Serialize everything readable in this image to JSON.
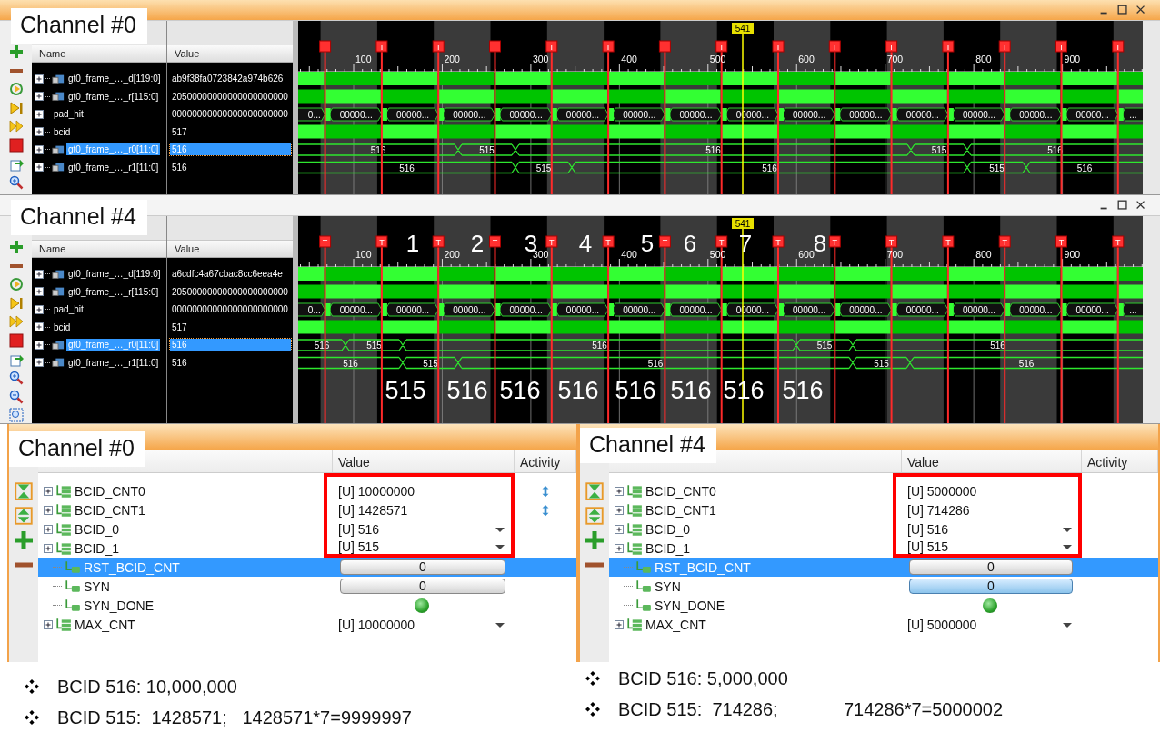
{
  "waveform_panels": [
    {
      "channel_label": "Channel #0",
      "active": true,
      "columns": [
        "Name",
        "Value"
      ],
      "cursor": "541",
      "ruler": [
        "100",
        "200",
        "300",
        "400",
        "500",
        "600",
        "700",
        "800",
        "900"
      ],
      "markers": [
        "T",
        "T",
        "T",
        "T",
        "T",
        "T",
        "T",
        "T",
        "T",
        "T",
        "T",
        "T",
        "T",
        "T",
        "T"
      ],
      "signals": [
        {
          "name": "gt0_frame_…_d[119:0]",
          "value": "ab9f38fa0723842a974b626",
          "kind": "bus",
          "selected": false,
          "trace": {
            "kind": "solid"
          }
        },
        {
          "name": "gt0_frame_…_r[115:0]",
          "value": "20500000000000000000000",
          "kind": "bus",
          "selected": false,
          "trace": {
            "kind": "solid"
          }
        },
        {
          "name": "pad_hit",
          "value": "00000000000000000000000",
          "kind": "bit",
          "selected": false,
          "trace": {
            "kind": "hex",
            "segments": [
              "0...",
              "00000...",
              "00000...",
              "00000...",
              "00000...",
              "00000...",
              "00000...",
              "00000...",
              "00000...",
              "00000...",
              "00000...",
              "00000...",
              "00000...",
              "00000...",
              "00000...",
              "..."
            ]
          }
        },
        {
          "name": "bcid",
          "value": "517",
          "kind": "bit",
          "selected": false,
          "trace": {
            "kind": "solid"
          }
        },
        {
          "name": "gt0_frame_…_r0[11:0]",
          "value": "516",
          "kind": "bus",
          "selected": true,
          "trace": {
            "kind": "value",
            "segments": [
              "516",
              "515",
              "516",
              "515",
              "516"
            ]
          }
        },
        {
          "name": "gt0_frame_…_r1[11:0]",
          "value": "516",
          "kind": "bus",
          "selected": false,
          "trace": {
            "kind": "value",
            "segments": [
              "516",
              "515",
              "516",
              "515",
              "516"
            ]
          }
        }
      ]
    },
    {
      "channel_label": "Channel #4",
      "active": false,
      "columns": [
        "Name",
        "Value"
      ],
      "cursor": "541",
      "ruler": [
        "100",
        "200",
        "300",
        "400",
        "500",
        "600",
        "700",
        "800",
        "900"
      ],
      "markers": [
        "T",
        "T",
        "T",
        "T",
        "T",
        "T",
        "T",
        "T",
        "T",
        "T",
        "T",
        "T",
        "T",
        "T",
        "T"
      ],
      "signals": [
        {
          "name": "gt0_frame_…_d[119:0]",
          "value": "a6cdfc4a67cbac8cc6eea4e",
          "kind": "bus",
          "selected": false,
          "trace": {
            "kind": "solid"
          }
        },
        {
          "name": "gt0_frame_…_r[115:0]",
          "value": "20500000000000000000000",
          "kind": "bus",
          "selected": false,
          "trace": {
            "kind": "solid"
          }
        },
        {
          "name": "pad_hit",
          "value": "00000000000000000000000",
          "kind": "bit",
          "selected": false,
          "trace": {
            "kind": "hex",
            "segments": [
              "0...",
              "00000...",
              "00000...",
              "00000...",
              "00000...",
              "00000...",
              "00000...",
              "00000...",
              "00000...",
              "00000...",
              "00000...",
              "00000...",
              "00000...",
              "00000...",
              "00000...",
              "..."
            ]
          }
        },
        {
          "name": "bcid",
          "value": "517",
          "kind": "bit",
          "selected": false,
          "trace": {
            "kind": "solid"
          }
        },
        {
          "name": "gt0_frame_…_r0[11:0]",
          "value": "516",
          "kind": "bus",
          "selected": true,
          "trace": {
            "kind": "value",
            "segments": [
              "516",
              "515",
              "516",
              "515",
              "516"
            ]
          }
        },
        {
          "name": "gt0_frame_…_r1[11:0]",
          "value": "516",
          "kind": "bus",
          "selected": false,
          "trace": {
            "kind": "value",
            "segments": [
              "516",
              "515",
              "516",
              "515",
              "516"
            ]
          }
        }
      ],
      "annotations": {
        "slots": [
          "1",
          "2",
          "3",
          "4",
          "5",
          "6",
          "7",
          "8"
        ],
        "readings": [
          "515",
          "516",
          "516",
          "516",
          "516",
          "516",
          "516",
          "516"
        ]
      }
    }
  ],
  "vio_panels": [
    {
      "channel_label": "Channel #0",
      "columns": [
        "Value",
        "Activity"
      ],
      "rows": [
        {
          "name": "BCID_CNT0",
          "kind": "register",
          "value": "[U] 10000000",
          "dropdown": false,
          "activity": true,
          "selected": false,
          "highlighted": true
        },
        {
          "name": "BCID_CNT1",
          "kind": "register",
          "value": "[U] 1428571",
          "dropdown": false,
          "activity": true,
          "selected": false,
          "highlighted": true
        },
        {
          "name": "BCID_0",
          "kind": "register",
          "value": "[U] 516",
          "dropdown": true,
          "activity": false,
          "selected": false,
          "highlighted": true
        },
        {
          "name": "BCID_1",
          "kind": "register",
          "value": "[U] 515",
          "dropdown": true,
          "activity": false,
          "selected": false,
          "highlighted": true
        },
        {
          "name": "RST_BCID_CNT",
          "kind": "button",
          "value": "0",
          "pressed": false,
          "selected": true,
          "highlighted": false
        },
        {
          "name": "SYN",
          "kind": "button",
          "value": "0",
          "pressed": false,
          "selected": false,
          "highlighted": false
        },
        {
          "name": "SYN_DONE",
          "kind": "led",
          "on": true,
          "selected": false,
          "highlighted": false
        },
        {
          "name": "MAX_CNT",
          "kind": "register",
          "value": "[U] 10000000",
          "dropdown": true,
          "selected": false
        }
      ],
      "notes": [
        "BCID 516: 10,000,000",
        "BCID 515:  1428571;   1428571*7=9999997"
      ]
    },
    {
      "channel_label": "Channel #4",
      "columns": [
        "Value",
        "Activity"
      ],
      "rows": [
        {
          "name": "BCID_CNT0",
          "kind": "register",
          "value": "[U] 5000000",
          "selected": false,
          "highlighted": true
        },
        {
          "name": "BCID_CNT1",
          "kind": "register",
          "value": "[U] 714286",
          "selected": false,
          "highlighted": true
        },
        {
          "name": "BCID_0",
          "kind": "register",
          "value": "[U] 516",
          "dropdown": true,
          "activity": false,
          "selected": false,
          "highlighted": true
        },
        {
          "name": "BCID_1",
          "kind": "register",
          "value": "[U] 515",
          "dropdown": true,
          "activity": false,
          "selected": false,
          "highlighted": true
        },
        {
          "name": "RST_BCID_CNT",
          "kind": "button",
          "value": "0",
          "pressed": false,
          "selected": true,
          "highlighted": false
        },
        {
          "name": "SYN",
          "kind": "button",
          "value": "0",
          "pressed": true,
          "selected": false,
          "highlighted": false
        },
        {
          "name": "SYN_DONE",
          "kind": "led",
          "on": true,
          "selected": false,
          "highlighted": false
        },
        {
          "name": "MAX_CNT",
          "kind": "register",
          "value": "[U] 5000000",
          "dropdown": true,
          "selected": false
        }
      ],
      "notes": [
        "BCID 516: 5,000,000",
        "BCID 515:  714286;             714286*7=5000002"
      ]
    }
  ]
}
